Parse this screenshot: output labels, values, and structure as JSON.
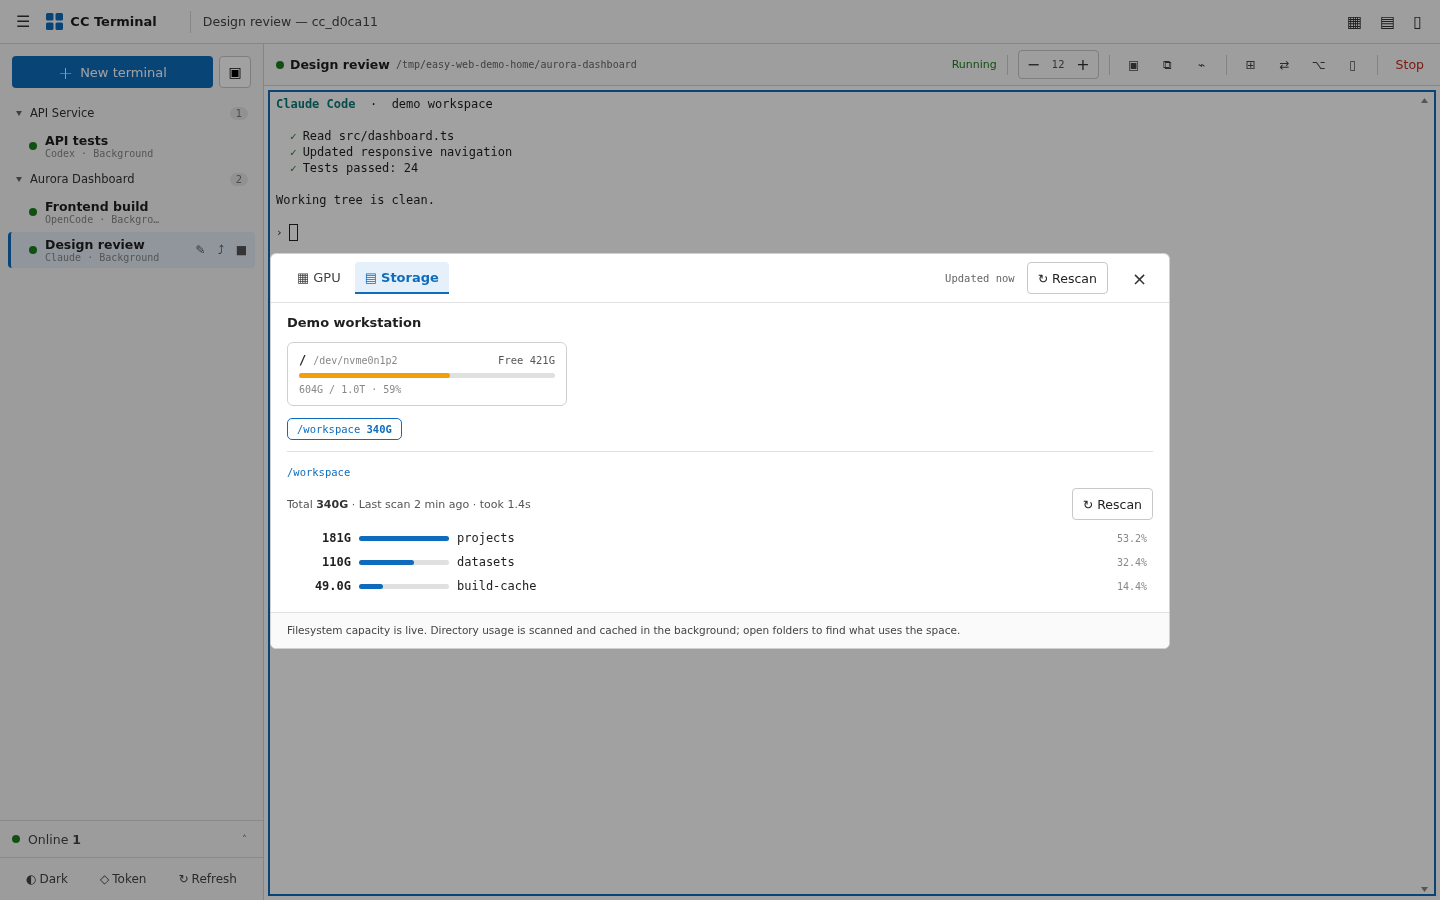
{
  "app": {
    "menu_icon": "☰",
    "title": "CC Terminal",
    "session_title": "Design review — cc_d0ca11",
    "actions": [
      "▦",
      "▤",
      "▯"
    ]
  },
  "sidebar": {
    "new_button": {
      "icon": "+",
      "label": "New terminal"
    },
    "side_button": "▣",
    "groups": [
      {
        "name": "API Service",
        "count": "1",
        "expanded": true,
        "items": [
          {
            "title": "API tests",
            "meta": "Codex · Background",
            "selected": false
          }
        ]
      },
      {
        "name": "Aurora Dashboard",
        "count": "2",
        "expanded": true,
        "items": [
          {
            "title": "Frontend build",
            "meta": "OpenCode · Backgro…",
            "selected": false
          },
          {
            "title": "Design review",
            "meta": "Claude · Background",
            "selected": true,
            "actions": [
              "✎",
              "⤴",
              "■"
            ]
          }
        ]
      }
    ],
    "status": {
      "label": "Online",
      "count": "1",
      "caret": "˄"
    },
    "footer": [
      {
        "icon": "◐",
        "label": "Dark"
      },
      {
        "icon": "◇",
        "label": "Token"
      },
      {
        "icon": "↻",
        "label": "Refresh"
      }
    ]
  },
  "terminal": {
    "title": "Design review",
    "path": "/tmp/easy-web-demo-home/aurora-dashboard",
    "status": "Running",
    "font_size": {
      "minus": "−",
      "value": "12",
      "plus": "+"
    },
    "tools_a": [
      "▣",
      "⧉",
      "⌁"
    ],
    "tools_b": [
      "⊞",
      "⇄",
      "⌥",
      "▯"
    ],
    "stop": "Stop",
    "lines": [
      {
        "kind": "header",
        "brand": "Claude Code",
        "sep": "·",
        "text": "demo workspace"
      },
      {
        "kind": "blank"
      },
      {
        "kind": "check",
        "mark": "✓",
        "text": "Read src/dashboard.ts"
      },
      {
        "kind": "check",
        "mark": "✓",
        "text": "Updated responsive navigation"
      },
      {
        "kind": "check",
        "mark": "✓",
        "text": "Tests passed: 24"
      },
      {
        "kind": "blank"
      },
      {
        "kind": "plain",
        "text": "Working tree is clean."
      },
      {
        "kind": "blank"
      },
      {
        "kind": "prompt",
        "mark": "›"
      }
    ]
  },
  "dialog": {
    "tabs": [
      {
        "icon": "▦",
        "label": "GPU",
        "selected": false
      },
      {
        "icon": "▤",
        "label": "Storage",
        "selected": true
      }
    ],
    "updated": "Updated now",
    "rescan": {
      "icon": "↻",
      "label": "Rescan"
    },
    "close": "×",
    "host": "Demo workstation",
    "disks": [
      {
        "mount": "/",
        "device": "/dev/nvme0n1p2",
        "free": "Free 421G",
        "level": 0.59,
        "usage": "604G / 1.0T · 59%"
      }
    ],
    "chips": [
      {
        "path": "/workspace",
        "size": "340G",
        "selected": true
      }
    ],
    "scan": {
      "path": "/workspace",
      "summary": "Total **340G** · Last scan 2 min ago · took 1.4s",
      "rescan": {
        "icon": "↻",
        "label": "Rescan"
      },
      "rows": [
        {
          "size": "181G",
          "level": 1.0,
          "name": "projects",
          "percent": "53.2%"
        },
        {
          "size": "110G",
          "level": 0.61,
          "name": "datasets",
          "percent": "32.4%"
        },
        {
          "size": "49.0G",
          "level": 0.27,
          "name": "build-cache",
          "percent": "14.4%"
        }
      ]
    },
    "note": "Filesystem capacity is live. Directory usage is scanned and cached in the background; open folders to find what uses the space."
  }
}
